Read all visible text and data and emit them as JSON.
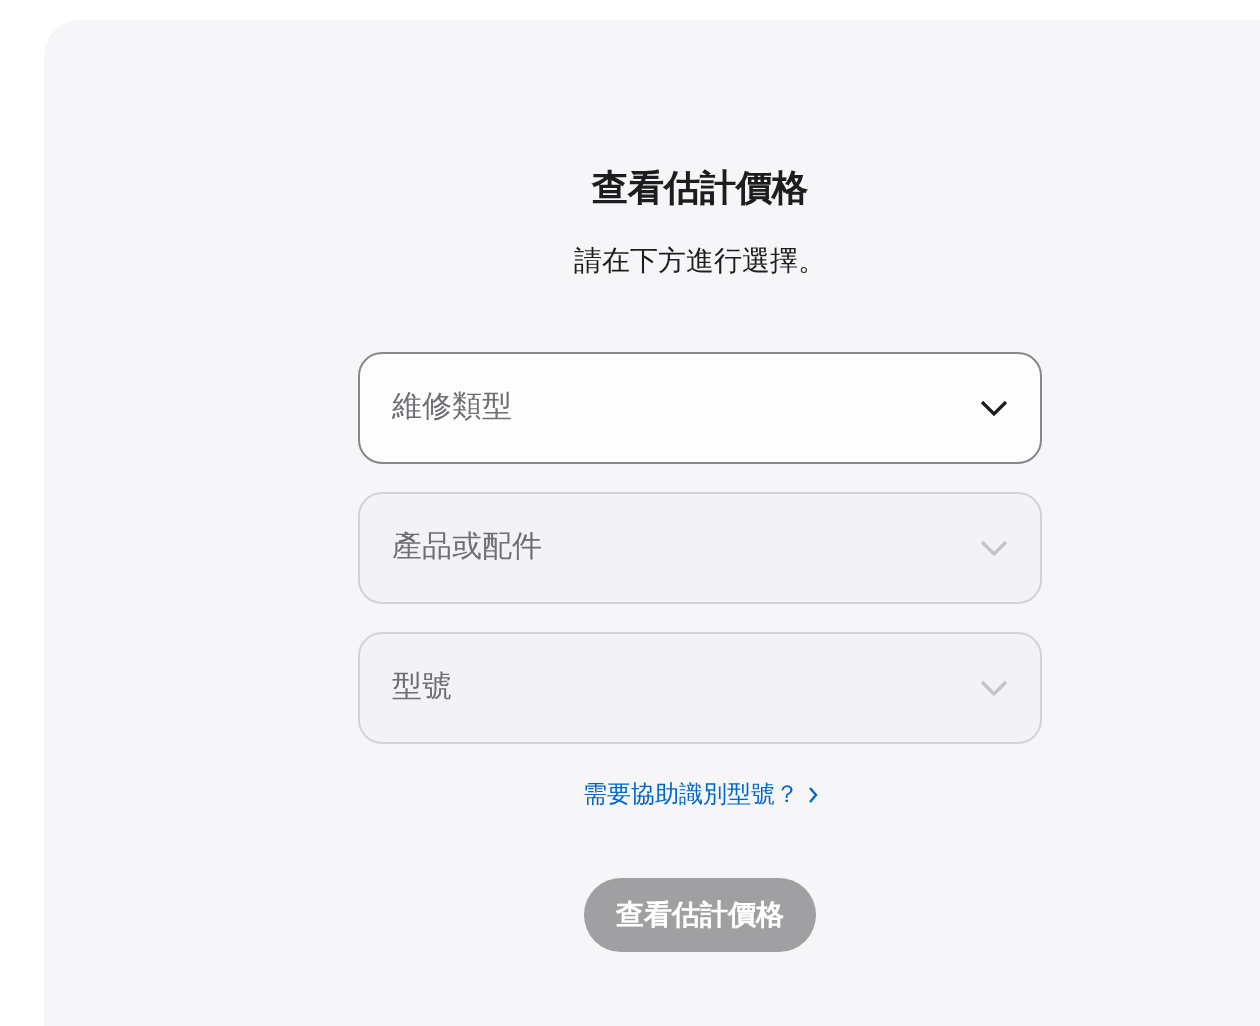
{
  "title": "查看估計價格",
  "subtitle": "請在下方進行選擇。",
  "selects": [
    {
      "placeholder": "維修類型",
      "disabled": false
    },
    {
      "placeholder": "產品或配件",
      "disabled": true
    },
    {
      "placeholder": "型號",
      "disabled": true
    }
  ],
  "help_link": "需要協助識別型號？",
  "submit": {
    "label": "查看估計價格",
    "disabled": true
  }
}
